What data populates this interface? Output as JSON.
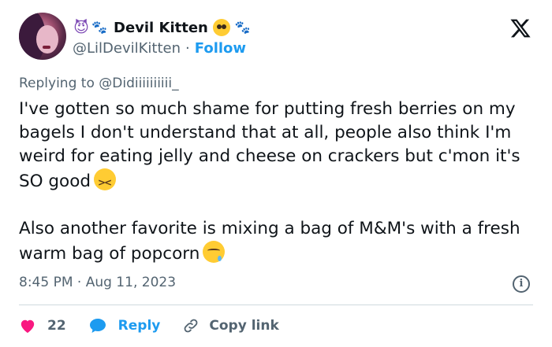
{
  "author": {
    "display_name": "Devil Kitten",
    "handle": "@LilDevilKitten",
    "separator": "·",
    "follow_label": "Follow",
    "emoji_devil": "😈",
    "emoji_paws": "🐾",
    "emoji_paws_2": "🐾"
  },
  "reply": {
    "prefix": "Replying to",
    "mention": "@Didiiiiiiiiii_"
  },
  "tweet": {
    "paragraph_1": "I've gotten so much shame for putting fresh berries on my bagels I don't understand that at all, people also think I'm weird for eating jelly and cheese on crackers but c'mon it's SO good",
    "paragraph_2": "Also another favorite is mixing a bag of M&M's with a fresh warm bag of popcorn"
  },
  "meta": {
    "timestamp": "8:45 PM · Aug 11, 2023"
  },
  "actions": {
    "like_count": "22",
    "reply_label": "Reply",
    "copy_link_label": "Copy link"
  },
  "icons": {
    "logo": "x-logo-icon",
    "info": "info-icon",
    "like": "heart-icon",
    "reply": "speech-bubble-icon",
    "copy": "link-icon"
  },
  "colors": {
    "accent": "#1d9bf0",
    "heart": "#f91880",
    "muted": "#536471",
    "text": "#0f1419"
  }
}
